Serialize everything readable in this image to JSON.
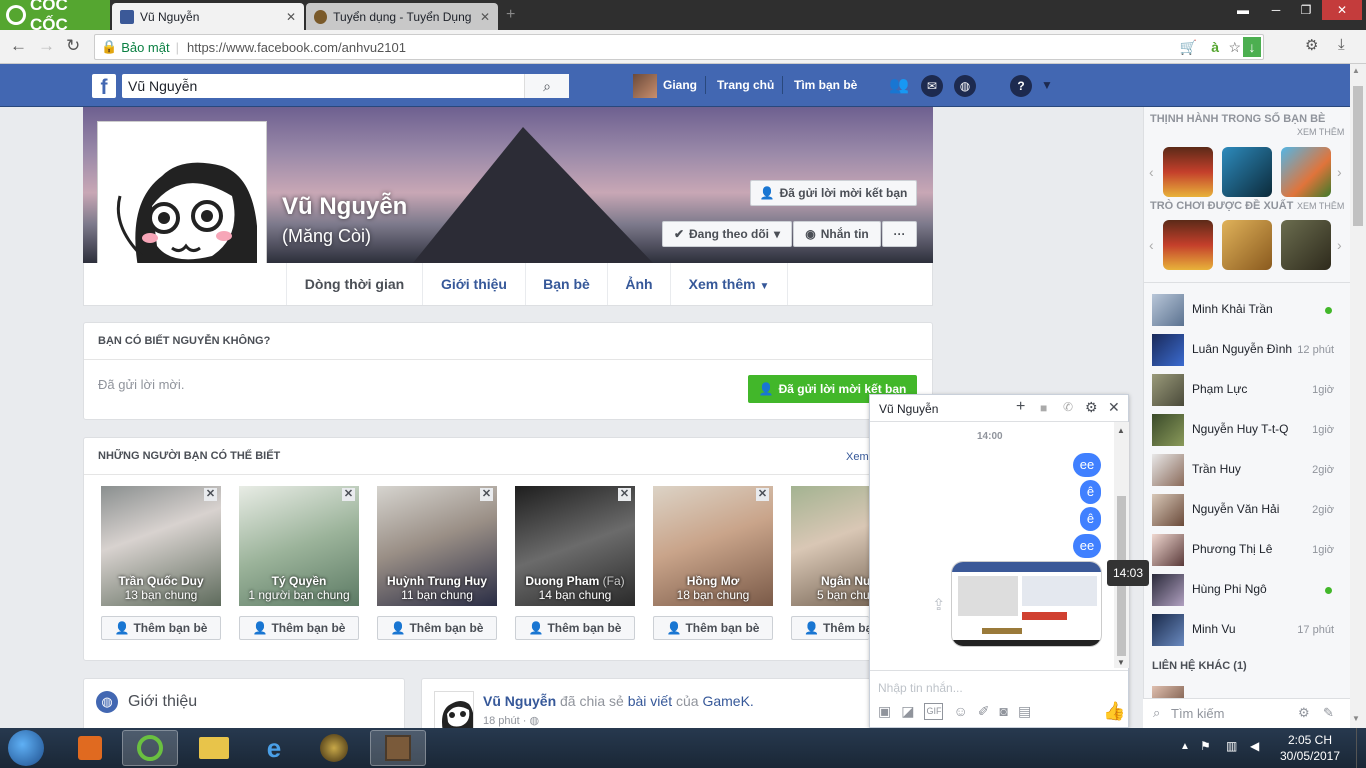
{
  "browser": {
    "brand": "CỐC CỐC",
    "tabs": [
      {
        "title": "Vũ Nguyễn",
        "active": true
      },
      {
        "title": "Tuyển dụng - Tuyển Dụng",
        "active": false
      }
    ],
    "security_label": "Bảo mật",
    "url": "https://www.facebook.com/anhvu2101"
  },
  "fb_header": {
    "search_value": "Vũ Nguyễn",
    "user_name": "Giang",
    "home": "Trang chủ",
    "find_friends": "Tìm bạn bè"
  },
  "profile": {
    "name": "Vũ Nguyễn",
    "nickname": "(Măng Còi)",
    "request_sent": "Đã gửi lời mời kết bạn",
    "following": "Đang theo dõi",
    "message": "Nhắn tin",
    "more": "···",
    "tabs": [
      "Dòng thời gian",
      "Giới thiệu",
      "Bạn bè",
      "Ảnh",
      "Xem thêm"
    ]
  },
  "know_card": {
    "title": "BẠN CÓ BIẾT NGUYỄN KHÔNG?",
    "status": "Đã gửi lời mời.",
    "button": "Đã gửi lời mời kết bạn"
  },
  "pymk": {
    "title": "NHỮNG NGƯỜI BẠN CÓ THỂ BIẾT",
    "see_all": "Xem",
    "add_label": "Thêm bạn bè",
    "people": [
      {
        "name": "Trần Quốc Duy",
        "mutual": "13 bạn chung"
      },
      {
        "name": "Tý Quyền",
        "mutual": "1 người bạn chung"
      },
      {
        "name": "Huỳnh Trung Huy",
        "mutual": "11 bạn chung"
      },
      {
        "name": "Duong Pham",
        "alt": "(Fa)",
        "mutual": "14 bạn chung"
      },
      {
        "name": "Hồng Mơ",
        "mutual": "18 bạn chung"
      },
      {
        "name": "Ngân Nu",
        "mutual": "5 bạn chu"
      }
    ]
  },
  "intro": {
    "title": "Giới thiệu"
  },
  "post": {
    "author": "Vũ Nguyễn",
    "shared": "đã chia sẻ",
    "link": "bài viết",
    "of": "của",
    "page": "GameK.",
    "time": "18 phút"
  },
  "sidebar": {
    "trending_title": "THỊNH HÀNH TRONG SỐ BẠN BÈ",
    "trending_more": "XEM THÊM",
    "games_title": "TRÒ CHƠI ĐƯỢC ĐỀ XUẤT",
    "games_more": "XEM THÊM",
    "contacts": [
      {
        "name": "Minh Khải Trần",
        "status": "online"
      },
      {
        "name": "Luân Nguyễn Đình",
        "status": "12 phút"
      },
      {
        "name": "Phạm Lực",
        "status": "1giờ"
      },
      {
        "name": "Nguyễn Huy T-t-Q",
        "status": "1giờ"
      },
      {
        "name": "Trần Huy",
        "status": "2giờ"
      },
      {
        "name": "Nguyễn Văn Hải",
        "status": "2giờ"
      },
      {
        "name": "Phương Thị Lê",
        "status": "1giờ"
      },
      {
        "name": "Hùng Phi Ngô",
        "status": "online"
      },
      {
        "name": "Minh Vu",
        "status": "17 phút"
      }
    ],
    "other_contacts": "LIÊN HỆ KHÁC (1)",
    "search_placeholder": "Tìm kiếm"
  },
  "chat": {
    "title": "Vũ Nguyễn",
    "time": "14:00",
    "messages": [
      "ee",
      "ê",
      "ê",
      "ee"
    ],
    "tooltip": "14:03",
    "input_placeholder": "Nhập tin nhắn..."
  },
  "taskbar": {
    "time": "2:05 CH",
    "date": "30/05/2017"
  },
  "colors": {
    "fb_blue": "#4267b2",
    "green": "#42b72a",
    "messenger_blue": "#4080ff"
  }
}
